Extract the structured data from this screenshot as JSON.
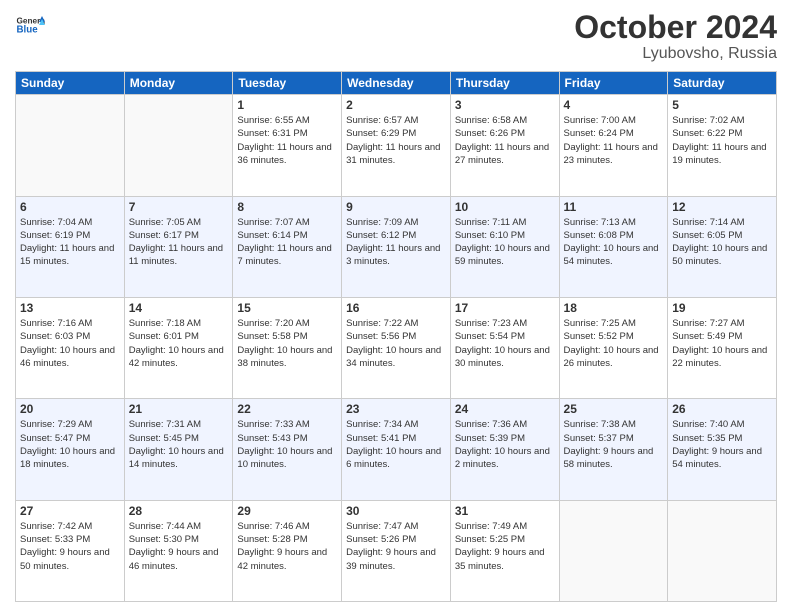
{
  "header": {
    "logo_general": "General",
    "logo_blue": "Blue",
    "month": "October 2024",
    "location": "Lyubovsho, Russia"
  },
  "days_of_week": [
    "Sunday",
    "Monday",
    "Tuesday",
    "Wednesday",
    "Thursday",
    "Friday",
    "Saturday"
  ],
  "weeks": [
    [
      {
        "day": "",
        "info": ""
      },
      {
        "day": "",
        "info": ""
      },
      {
        "day": "1",
        "info": "Sunrise: 6:55 AM\nSunset: 6:31 PM\nDaylight: 11 hours and 36 minutes."
      },
      {
        "day": "2",
        "info": "Sunrise: 6:57 AM\nSunset: 6:29 PM\nDaylight: 11 hours and 31 minutes."
      },
      {
        "day": "3",
        "info": "Sunrise: 6:58 AM\nSunset: 6:26 PM\nDaylight: 11 hours and 27 minutes."
      },
      {
        "day": "4",
        "info": "Sunrise: 7:00 AM\nSunset: 6:24 PM\nDaylight: 11 hours and 23 minutes."
      },
      {
        "day": "5",
        "info": "Sunrise: 7:02 AM\nSunset: 6:22 PM\nDaylight: 11 hours and 19 minutes."
      }
    ],
    [
      {
        "day": "6",
        "info": "Sunrise: 7:04 AM\nSunset: 6:19 PM\nDaylight: 11 hours and 15 minutes."
      },
      {
        "day": "7",
        "info": "Sunrise: 7:05 AM\nSunset: 6:17 PM\nDaylight: 11 hours and 11 minutes."
      },
      {
        "day": "8",
        "info": "Sunrise: 7:07 AM\nSunset: 6:14 PM\nDaylight: 11 hours and 7 minutes."
      },
      {
        "day": "9",
        "info": "Sunrise: 7:09 AM\nSunset: 6:12 PM\nDaylight: 11 hours and 3 minutes."
      },
      {
        "day": "10",
        "info": "Sunrise: 7:11 AM\nSunset: 6:10 PM\nDaylight: 10 hours and 59 minutes."
      },
      {
        "day": "11",
        "info": "Sunrise: 7:13 AM\nSunset: 6:08 PM\nDaylight: 10 hours and 54 minutes."
      },
      {
        "day": "12",
        "info": "Sunrise: 7:14 AM\nSunset: 6:05 PM\nDaylight: 10 hours and 50 minutes."
      }
    ],
    [
      {
        "day": "13",
        "info": "Sunrise: 7:16 AM\nSunset: 6:03 PM\nDaylight: 10 hours and 46 minutes."
      },
      {
        "day": "14",
        "info": "Sunrise: 7:18 AM\nSunset: 6:01 PM\nDaylight: 10 hours and 42 minutes."
      },
      {
        "day": "15",
        "info": "Sunrise: 7:20 AM\nSunset: 5:58 PM\nDaylight: 10 hours and 38 minutes."
      },
      {
        "day": "16",
        "info": "Sunrise: 7:22 AM\nSunset: 5:56 PM\nDaylight: 10 hours and 34 minutes."
      },
      {
        "day": "17",
        "info": "Sunrise: 7:23 AM\nSunset: 5:54 PM\nDaylight: 10 hours and 30 minutes."
      },
      {
        "day": "18",
        "info": "Sunrise: 7:25 AM\nSunset: 5:52 PM\nDaylight: 10 hours and 26 minutes."
      },
      {
        "day": "19",
        "info": "Sunrise: 7:27 AM\nSunset: 5:49 PM\nDaylight: 10 hours and 22 minutes."
      }
    ],
    [
      {
        "day": "20",
        "info": "Sunrise: 7:29 AM\nSunset: 5:47 PM\nDaylight: 10 hours and 18 minutes."
      },
      {
        "day": "21",
        "info": "Sunrise: 7:31 AM\nSunset: 5:45 PM\nDaylight: 10 hours and 14 minutes."
      },
      {
        "day": "22",
        "info": "Sunrise: 7:33 AM\nSunset: 5:43 PM\nDaylight: 10 hours and 10 minutes."
      },
      {
        "day": "23",
        "info": "Sunrise: 7:34 AM\nSunset: 5:41 PM\nDaylight: 10 hours and 6 minutes."
      },
      {
        "day": "24",
        "info": "Sunrise: 7:36 AM\nSunset: 5:39 PM\nDaylight: 10 hours and 2 minutes."
      },
      {
        "day": "25",
        "info": "Sunrise: 7:38 AM\nSunset: 5:37 PM\nDaylight: 9 hours and 58 minutes."
      },
      {
        "day": "26",
        "info": "Sunrise: 7:40 AM\nSunset: 5:35 PM\nDaylight: 9 hours and 54 minutes."
      }
    ],
    [
      {
        "day": "27",
        "info": "Sunrise: 7:42 AM\nSunset: 5:33 PM\nDaylight: 9 hours and 50 minutes."
      },
      {
        "day": "28",
        "info": "Sunrise: 7:44 AM\nSunset: 5:30 PM\nDaylight: 9 hours and 46 minutes."
      },
      {
        "day": "29",
        "info": "Sunrise: 7:46 AM\nSunset: 5:28 PM\nDaylight: 9 hours and 42 minutes."
      },
      {
        "day": "30",
        "info": "Sunrise: 7:47 AM\nSunset: 5:26 PM\nDaylight: 9 hours and 39 minutes."
      },
      {
        "day": "31",
        "info": "Sunrise: 7:49 AM\nSunset: 5:25 PM\nDaylight: 9 hours and 35 minutes."
      },
      {
        "day": "",
        "info": ""
      },
      {
        "day": "",
        "info": ""
      }
    ]
  ]
}
